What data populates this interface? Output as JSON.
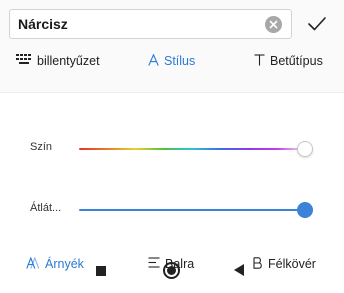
{
  "input": {
    "value": "Nárcisz"
  },
  "tabs": [
    {
      "icon": "keyboard-icon",
      "label": "billentyűzet",
      "active": false
    },
    {
      "icon": "style-icon",
      "label": "Stílus",
      "active": true
    },
    {
      "icon": "font-icon",
      "label": "Betűtípus",
      "active": false
    }
  ],
  "sliders": {
    "color": {
      "label": "Szín",
      "value": 1.0
    },
    "opacity": {
      "label": "Átlát...",
      "value": 1.0
    }
  },
  "bottom": [
    {
      "icon": "shadow-icon",
      "label": "Árnyék",
      "active": true
    },
    {
      "icon": "align-left-icon",
      "label": "Balra",
      "active": false
    },
    {
      "icon": "bold-icon",
      "label": "Félkövér",
      "active": false
    }
  ],
  "colors": {
    "accent": "#2b7ad6",
    "slider_blue": "#3b82d8"
  }
}
